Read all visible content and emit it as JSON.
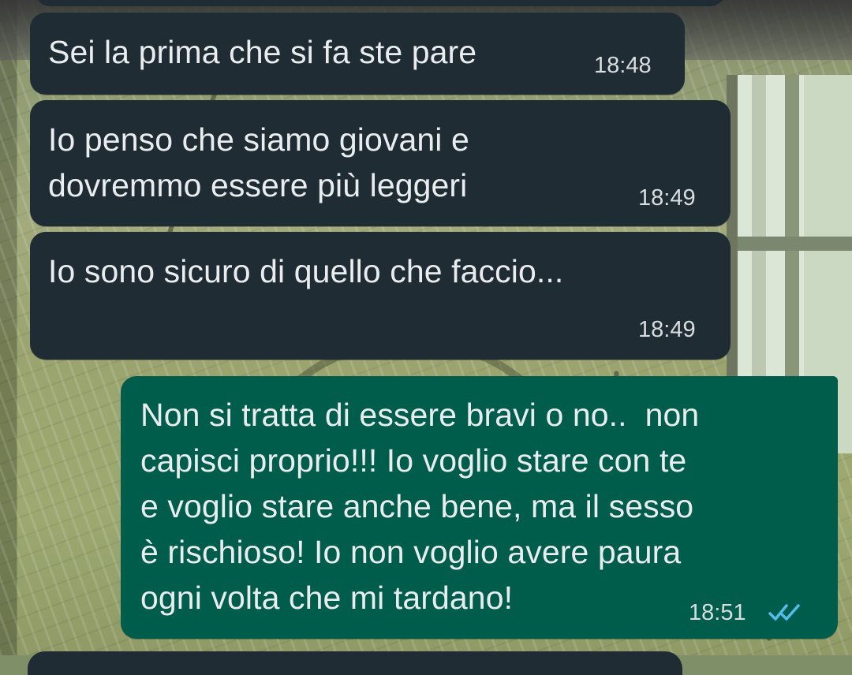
{
  "messages": [
    {
      "direction": "incoming",
      "text": "Sei la prima che si fa ste pare",
      "time": "18:48"
    },
    {
      "direction": "incoming",
      "text": "Io penso che siamo giovani e\ndovremmo essere più leggeri",
      "time": "18:49"
    },
    {
      "direction": "incoming",
      "text": "Io sono sicuro di quello che faccio...",
      "time": "18:49"
    },
    {
      "direction": "outgoing",
      "text": "Non si tratta di essere bravi o no..  non\ncapisci proprio!!! Io voglio stare con te\ne voglio stare anche bene, ma il sesso\nè rischioso! Io non voglio avere paura\nogni volta che mi tardano!",
      "time": "18:51",
      "status_icon": "double-check-read-icon"
    }
  ],
  "colors": {
    "incoming_bubble": "#202c33",
    "outgoing_bubble": "#005c4b",
    "message_text": "#e9edef",
    "read_receipt": "#53bdeb"
  }
}
